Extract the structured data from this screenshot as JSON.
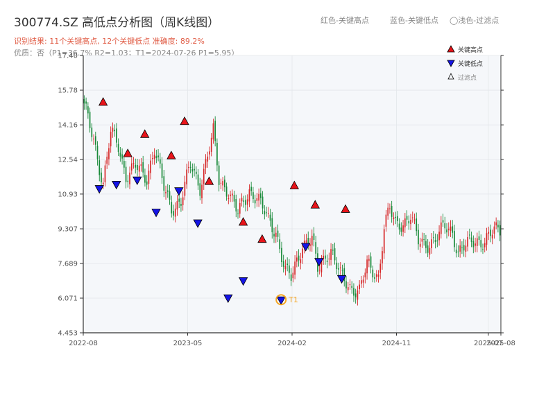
{
  "chart_data": {
    "type": "candlestick",
    "title": "300774.SZ 高低点分析图（周K线图）",
    "subtitle_result": "识别结果: 11个关键高点, 12个关键低点  准确度: 89.2%",
    "subtitle_quality": "优质：否（P1=36.7%  R2=1.03；T1=2024-07-26 P1=5.95）",
    "top_legend": [
      "红色-关键高点",
      "蓝色-关键低点",
      "◯浅色-过滤点"
    ],
    "legend": [
      "关键高点",
      "关键低点",
      "过滤点"
    ],
    "ylim": [
      4.453,
      17.4
    ],
    "y_ticks": [
      "17.40",
      "15.78",
      "14.16",
      "12.54",
      "10.93",
      "9.307",
      "7.689",
      "6.071",
      "4.453"
    ],
    "x_ticks": [
      {
        "label": "2022-08",
        "pos": 0.0
      },
      {
        "label": "2023-05",
        "pos": 0.25
      },
      {
        "label": "2024-02",
        "pos": 0.5
      },
      {
        "label": "2024-11",
        "pos": 0.75
      },
      {
        "label": "2025-07",
        "pos": 0.97
      },
      {
        "label": "2025-08",
        "pos": 1.0
      }
    ],
    "t1_label": "T1",
    "colors": {
      "up": "#d62728",
      "down": "#1a8a3a",
      "high": "#e8141a",
      "low": "#1414e6",
      "t1": "#f5a623"
    },
    "close_keypoints": [
      [
        0,
        15.0
      ],
      [
        5,
        13.5
      ],
      [
        10,
        11.4
      ],
      [
        14,
        13.8
      ],
      [
        18,
        13.2
      ],
      [
        22,
        11.8
      ],
      [
        27,
        12.2
      ],
      [
        33,
        11.7
      ],
      [
        37,
        13.1
      ],
      [
        42,
        11.2
      ],
      [
        46,
        10.3
      ],
      [
        51,
        10.6
      ],
      [
        56,
        12.3
      ],
      [
        61,
        11.3
      ],
      [
        68,
        13.8
      ],
      [
        71,
        11.6
      ],
      [
        76,
        11.1
      ],
      [
        81,
        10.0
      ],
      [
        87,
        11.1
      ],
      [
        91,
        10.8
      ],
      [
        97,
        9.7
      ],
      [
        101,
        9.2
      ],
      [
        106,
        7.3
      ],
      [
        109,
        7.0
      ],
      [
        115,
        8.6
      ],
      [
        120,
        8.8
      ],
      [
        123,
        7.4
      ],
      [
        128,
        8.2
      ],
      [
        130,
        8.3
      ],
      [
        135,
        7.1
      ],
      [
        140,
        6.6
      ],
      [
        143,
        6.5
      ],
      [
        145,
        6.4
      ],
      [
        149,
        7.6
      ],
      [
        155,
        7.1
      ],
      [
        158,
        9.4
      ],
      [
        161,
        10.2
      ],
      [
        164,
        9.5
      ],
      [
        168,
        9.6
      ],
      [
        172,
        9.9
      ],
      [
        176,
        8.7
      ],
      [
        180,
        8.6
      ],
      [
        185,
        8.8
      ],
      [
        190,
        9.4
      ],
      [
        194,
        9.2
      ],
      [
        197,
        8.2
      ],
      [
        201,
        8.5
      ],
      [
        206,
        8.8
      ],
      [
        211,
        8.7
      ],
      [
        216,
        9.2
      ],
      [
        219,
        9.3
      ]
    ],
    "key_highs": [
      [
        10,
        15.2
      ],
      [
        23,
        12.8
      ],
      [
        32,
        13.7
      ],
      [
        46,
        12.7
      ],
      [
        53,
        14.3
      ],
      [
        66,
        11.5
      ],
      [
        84,
        9.6
      ],
      [
        94,
        8.8
      ],
      [
        111,
        11.3
      ],
      [
        122,
        10.4
      ],
      [
        138,
        10.2
      ]
    ],
    "key_lows": [
      [
        8,
        11.2
      ],
      [
        17,
        11.4
      ],
      [
        28,
        11.6
      ],
      [
        38,
        10.1
      ],
      [
        50,
        11.1
      ],
      [
        60,
        9.6
      ],
      [
        76,
        6.1
      ],
      [
        84,
        6.9
      ],
      [
        104,
        6.0
      ],
      [
        117,
        8.5
      ],
      [
        124,
        7.8
      ],
      [
        136,
        7.0
      ]
    ],
    "t1": [
      104,
      6.0
    ]
  }
}
